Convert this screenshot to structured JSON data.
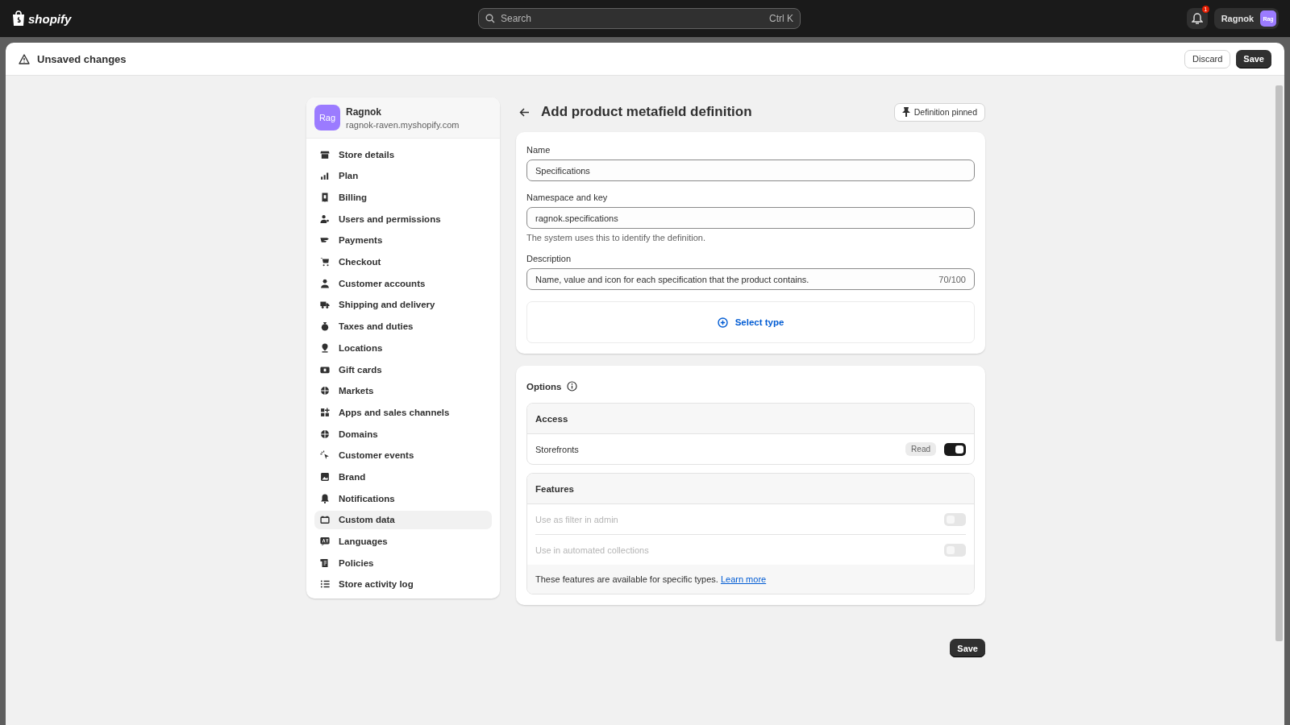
{
  "topbar": {
    "logo": "shopify",
    "search": {
      "placeholder": "Search",
      "shortcut": "Ctrl K"
    },
    "notification_count": "1",
    "user": {
      "name": "Ragnok",
      "initials": "Rag"
    }
  },
  "save_bar": {
    "title": "Unsaved changes",
    "discard": "Discard",
    "save": "Save"
  },
  "store": {
    "initials": "Rag",
    "name": "Ragnok",
    "domain": "ragnok-raven.myshopify.com"
  },
  "sidebar": {
    "items": [
      {
        "label": "Store details",
        "selected": false
      },
      {
        "label": "Plan",
        "selected": false
      },
      {
        "label": "Billing",
        "selected": false
      },
      {
        "label": "Users and permissions",
        "selected": false
      },
      {
        "label": "Payments",
        "selected": false
      },
      {
        "label": "Checkout",
        "selected": false
      },
      {
        "label": "Customer accounts",
        "selected": false
      },
      {
        "label": "Shipping and delivery",
        "selected": false
      },
      {
        "label": "Taxes and duties",
        "selected": false
      },
      {
        "label": "Locations",
        "selected": false
      },
      {
        "label": "Gift cards",
        "selected": false
      },
      {
        "label": "Markets",
        "selected": false
      },
      {
        "label": "Apps and sales channels",
        "selected": false
      },
      {
        "label": "Domains",
        "selected": false
      },
      {
        "label": "Customer events",
        "selected": false
      },
      {
        "label": "Brand",
        "selected": false
      },
      {
        "label": "Notifications",
        "selected": false
      },
      {
        "label": "Custom data",
        "selected": true
      },
      {
        "label": "Languages",
        "selected": false
      },
      {
        "label": "Policies",
        "selected": false
      },
      {
        "label": "Store activity log",
        "selected": false
      }
    ]
  },
  "page": {
    "title": "Add product metafield definition",
    "pinned_button": "Definition pinned"
  },
  "form": {
    "fields": [
      {
        "label": "Name",
        "value": "Specifications"
      },
      {
        "label": "Namespace and key",
        "value": "ragnok.specifications",
        "help": "The system uses this to identify the definition."
      },
      {
        "label": "Description",
        "value": "Name, value and icon for each specification that the product contains.",
        "counter": "70/100"
      }
    ],
    "select_type": "Select type"
  },
  "options": {
    "title": "Options",
    "sections": [
      {
        "title": "Access",
        "rows": [
          {
            "label": "Storefronts",
            "badge": "Read",
            "on": true,
            "disabled": false
          }
        ]
      },
      {
        "title": "Features",
        "rows": [
          {
            "label": "Use as filter in admin",
            "on": false,
            "disabled": true
          },
          {
            "label": "Use in automated collections",
            "on": false,
            "disabled": true
          }
        ],
        "footer": "These features are available for specific types.",
        "footer_link": "Learn more"
      }
    ]
  },
  "footer_save": "Save"
}
